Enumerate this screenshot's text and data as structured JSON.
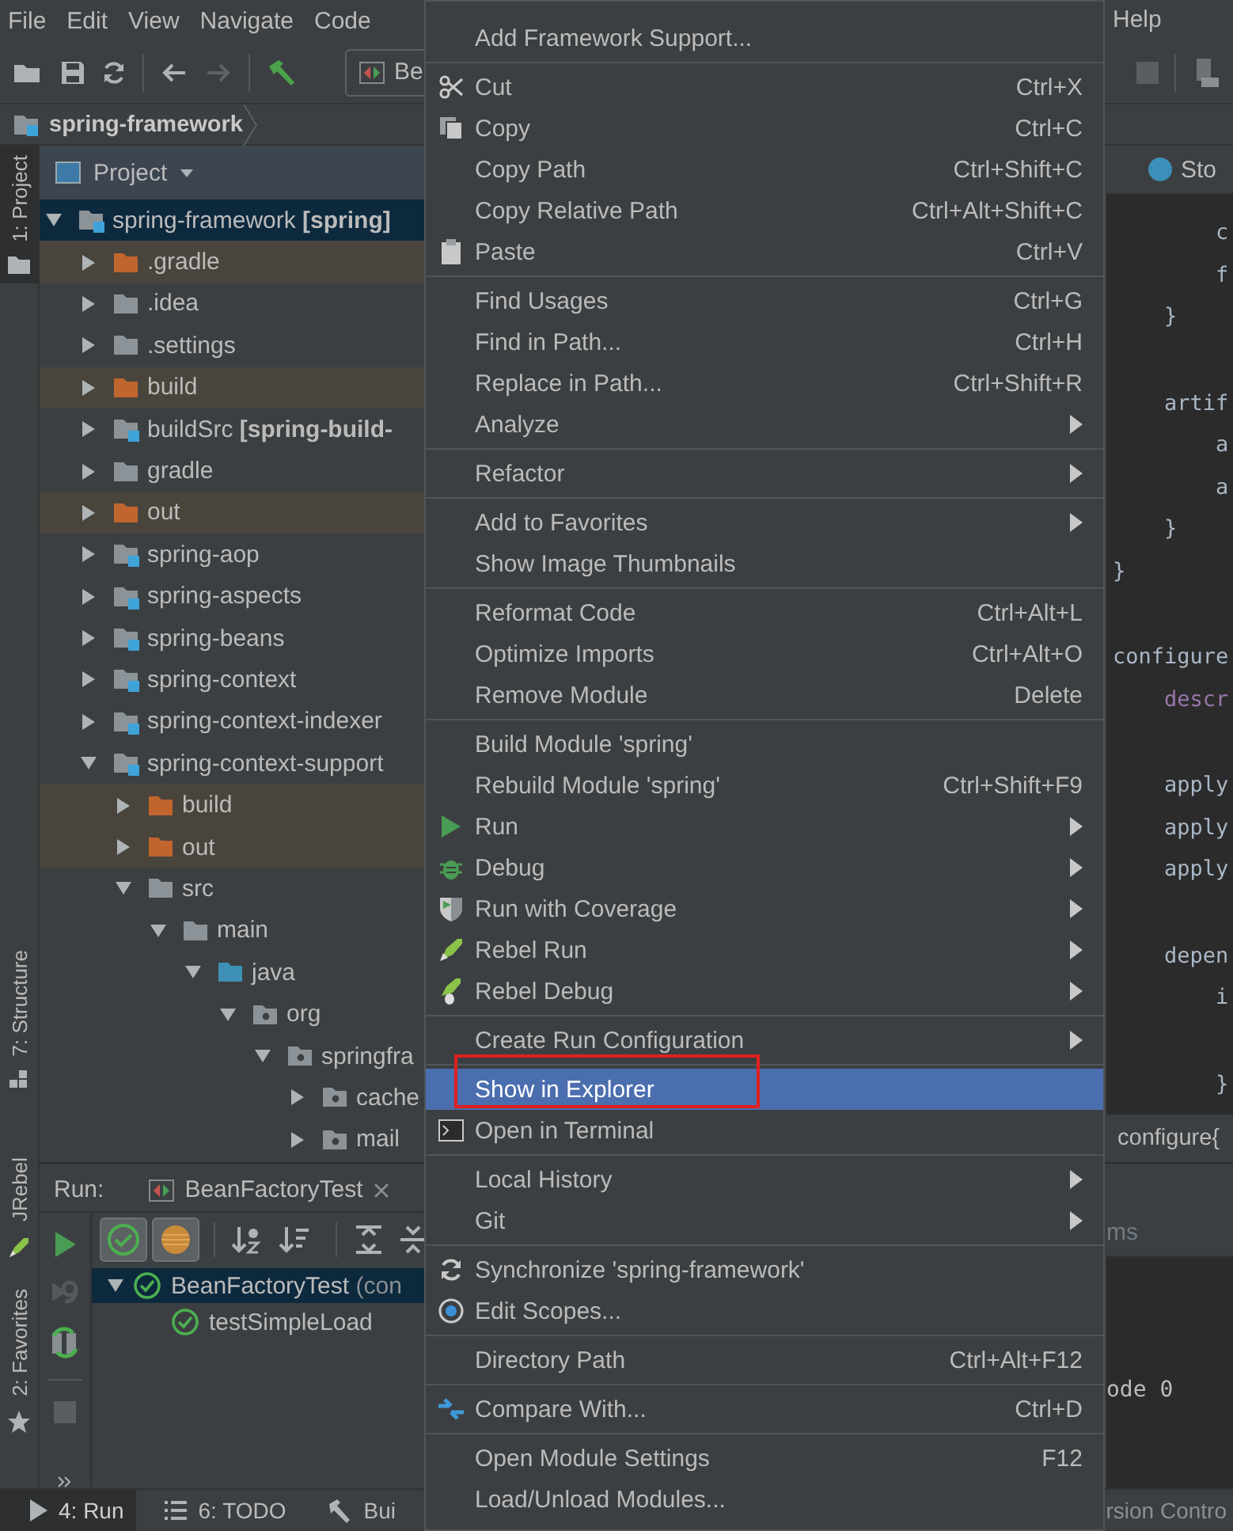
{
  "menubar": [
    "File",
    "Edit",
    "View",
    "Navigate",
    "Code",
    "Help"
  ],
  "toolbar": {
    "run_config": "Be"
  },
  "breadcrumb": "spring-framework",
  "side_stripe": {
    "top": [
      {
        "label": "1: Project",
        "selected": true
      },
      {
        "label": "7: Structure",
        "selected": false
      }
    ],
    "bottom": [
      {
        "label": "JRebel",
        "selected": false
      },
      {
        "label": "2: Favorites",
        "selected": false
      }
    ]
  },
  "project": {
    "title": "Project",
    "tree": [
      {
        "label": "spring-framework **[spring]**",
        "kind": "module",
        "expanded": true,
        "selected": true,
        "children": [
          {
            "label": ".gradle",
            "kind": "excluded",
            "expanded": false,
            "selected": false
          },
          {
            "label": ".idea",
            "kind": "folder",
            "expanded": false,
            "selected": false
          },
          {
            "label": ".settings",
            "kind": "folder",
            "expanded": false,
            "selected": false
          },
          {
            "label": "build",
            "kind": "excluded",
            "expanded": false,
            "selected": false
          },
          {
            "label": "buildSrc **[spring-build-**",
            "kind": "module",
            "expanded": false,
            "selected": false
          },
          {
            "label": "gradle",
            "kind": "folder",
            "expanded": false,
            "selected": false
          },
          {
            "label": "out",
            "kind": "excluded",
            "expanded": false,
            "selected": false
          },
          {
            "label": "spring-aop",
            "kind": "module",
            "expanded": false,
            "selected": false
          },
          {
            "label": "spring-aspects",
            "kind": "module",
            "expanded": false,
            "selected": false
          },
          {
            "label": "spring-beans",
            "kind": "module",
            "expanded": false,
            "selected": false
          },
          {
            "label": "spring-context",
            "kind": "module",
            "expanded": false,
            "selected": false
          },
          {
            "label": "spring-context-indexer",
            "kind": "module",
            "expanded": false,
            "selected": false
          },
          {
            "label": "spring-context-support",
            "kind": "module",
            "expanded": true,
            "selected": false,
            "children": [
              {
                "label": "build",
                "kind": "excluded",
                "expanded": false,
                "selected": false
              },
              {
                "label": "out",
                "kind": "excluded",
                "expanded": false,
                "selected": false
              },
              {
                "label": "src",
                "kind": "folder",
                "expanded": true,
                "selected": false,
                "children": [
                  {
                    "label": "main",
                    "kind": "folder",
                    "expanded": true,
                    "selected": false,
                    "children": [
                      {
                        "label": "java",
                        "kind": "source",
                        "expanded": true,
                        "selected": false,
                        "children": [
                          {
                            "label": "org",
                            "kind": "package",
                            "expanded": true,
                            "selected": false,
                            "children": [
                              {
                                "label": "springfra",
                                "kind": "package",
                                "expanded": true,
                                "selected": false,
                                "children": [
                                  {
                                    "label": "cache",
                                    "kind": "package",
                                    "expanded": false,
                                    "selected": false
                                  },
                                  {
                                    "label": "mail",
                                    "kind": "package",
                                    "expanded": false,
                                    "selected": false
                                  }
                                ]
                              }
                            ]
                          }
                        ]
                      }
                    ]
                  }
                ]
              }
            ]
          }
        ]
      }
    ]
  },
  "editor": {
    "tab": "Sto",
    "groups": [
      [
        {
          "text": "        c",
          "kind": "plain"
        },
        {
          "text": "        f",
          "kind": "plain"
        },
        {
          "text": "    }",
          "kind": "plain"
        }
      ],
      [
        {
          "text": "    artif",
          "kind": "plain"
        },
        {
          "text": "        a",
          "kind": "plain"
        },
        {
          "text": "        a",
          "kind": "plain"
        },
        {
          "text": "    }",
          "kind": "plain"
        },
        {
          "text": "}",
          "kind": "plain"
        }
      ],
      [
        {
          "text": "configure",
          "kind": "plain"
        },
        {
          "text": "    descr",
          "kind": "property"
        }
      ],
      [
        {
          "text": "    apply",
          "kind": "plain"
        },
        {
          "text": "    apply",
          "kind": "plain"
        },
        {
          "text": "    apply",
          "kind": "plain"
        }
      ],
      [
        {
          "text": "    depen",
          "kind": "plain"
        },
        {
          "text": "        i",
          "kind": "plain"
        }
      ],
      [
        {
          "text": "        }",
          "kind": "plain"
        }
      ]
    ],
    "breadcrumb": "configure{"
  },
  "context_menu": {
    "groups": [
      [
        {
          "label": "Add Framework Support...",
          "submenu": false,
          "selected": false,
          "marked": false
        }
      ],
      [
        {
          "label": "Cut",
          "shortcut": "Ctrl+X",
          "submenu": false,
          "selected": false,
          "marked": false
        },
        {
          "label": "Copy",
          "shortcut": "Ctrl+C",
          "submenu": false,
          "selected": false,
          "marked": false
        },
        {
          "label": "Copy Path",
          "shortcut": "Ctrl+Shift+C",
          "submenu": false,
          "selected": false,
          "marked": false
        },
        {
          "label": "Copy Relative Path",
          "shortcut": "Ctrl+Alt+Shift+C",
          "submenu": false,
          "selected": false,
          "marked": false
        },
        {
          "label": "Paste",
          "shortcut": "Ctrl+V",
          "submenu": false,
          "selected": false,
          "marked": false
        }
      ],
      [
        {
          "label": "Find Usages",
          "shortcut": "Ctrl+G",
          "submenu": false,
          "selected": false,
          "marked": false
        },
        {
          "label": "Find in Path...",
          "shortcut": "Ctrl+H",
          "submenu": false,
          "selected": false,
          "marked": false
        },
        {
          "label": "Replace in Path...",
          "shortcut": "Ctrl+Shift+R",
          "submenu": false,
          "selected": false,
          "marked": false
        },
        {
          "label": "Analyze",
          "submenu": true,
          "selected": false,
          "marked": false
        }
      ],
      [
        {
          "label": "Refactor",
          "submenu": true,
          "selected": false,
          "marked": false
        }
      ],
      [
        {
          "label": "Add to Favorites",
          "submenu": true,
          "selected": false,
          "marked": false
        },
        {
          "label": "Show Image Thumbnails",
          "submenu": false,
          "selected": false,
          "marked": false
        }
      ],
      [
        {
          "label": "Reformat Code",
          "shortcut": "Ctrl+Alt+L",
          "submenu": false,
          "selected": false,
          "marked": false
        },
        {
          "label": "Optimize Imports",
          "shortcut": "Ctrl+Alt+O",
          "submenu": false,
          "selected": false,
          "marked": false
        },
        {
          "label": "Remove Module",
          "shortcut": "Delete",
          "submenu": false,
          "selected": false,
          "marked": false
        }
      ],
      [
        {
          "label": "Build Module 'spring'",
          "submenu": false,
          "selected": false,
          "marked": false
        },
        {
          "label": "Rebuild Module 'spring'",
          "shortcut": "Ctrl+Shift+F9",
          "submenu": false,
          "selected": false,
          "marked": false
        },
        {
          "label": "Run",
          "submenu": true,
          "selected": false,
          "marked": false
        },
        {
          "label": "Debug",
          "submenu": true,
          "selected": false,
          "marked": false
        },
        {
          "label": "Run with Coverage",
          "submenu": true,
          "selected": false,
          "marked": false
        },
        {
          "label": "Rebel Run",
          "submenu": true,
          "selected": false,
          "marked": false
        },
        {
          "label": "Rebel Debug",
          "submenu": true,
          "selected": false,
          "marked": false
        }
      ],
      [
        {
          "label": "Create Run Configuration",
          "submenu": true,
          "selected": false,
          "marked": false
        }
      ],
      [
        {
          "label": "Show in Explorer",
          "submenu": false,
          "selected": true,
          "marked": true
        },
        {
          "label": "Open in Terminal",
          "submenu": false,
          "selected": false,
          "marked": false
        }
      ],
      [
        {
          "label": "Local History",
          "submenu": true,
          "selected": false,
          "marked": false
        },
        {
          "label": "Git",
          "submenu": true,
          "selected": false,
          "marked": false
        }
      ],
      [
        {
          "label": "Synchronize 'spring-framework'",
          "submenu": false,
          "selected": false,
          "marked": false
        },
        {
          "label": "Edit Scopes...",
          "submenu": false,
          "selected": false,
          "marked": false
        }
      ],
      [
        {
          "label": "Directory Path",
          "shortcut": "Ctrl+Alt+F12",
          "submenu": false,
          "selected": false,
          "marked": false
        }
      ],
      [
        {
          "label": "Compare With...",
          "shortcut": "Ctrl+D",
          "submenu": false,
          "selected": false,
          "marked": false
        }
      ],
      [
        {
          "label": "Open Module Settings",
          "shortcut": "F12",
          "submenu": false,
          "selected": false,
          "marked": false
        },
        {
          "label": "Load/Unload Modules...",
          "submenu": false,
          "selected": false,
          "marked": false
        }
      ]
    ]
  },
  "run": {
    "title": "Run:",
    "tab": "BeanFactoryTest",
    "tests": [
      {
        "label": "BeanFactoryTest",
        "detail": "(con",
        "expanded": true,
        "selected": true
      },
      {
        "label": "testSimpleLoad",
        "selected": false
      }
    ]
  },
  "problems_tab": "ms",
  "console_text": "ode 0",
  "bottom_tabs": [
    {
      "label": "4: Run",
      "selected": true
    },
    {
      "label": "6: TODO",
      "selected": false
    },
    {
      "label": "Bui",
      "selected": false
    }
  ],
  "status_bar": "rsion Contro"
}
